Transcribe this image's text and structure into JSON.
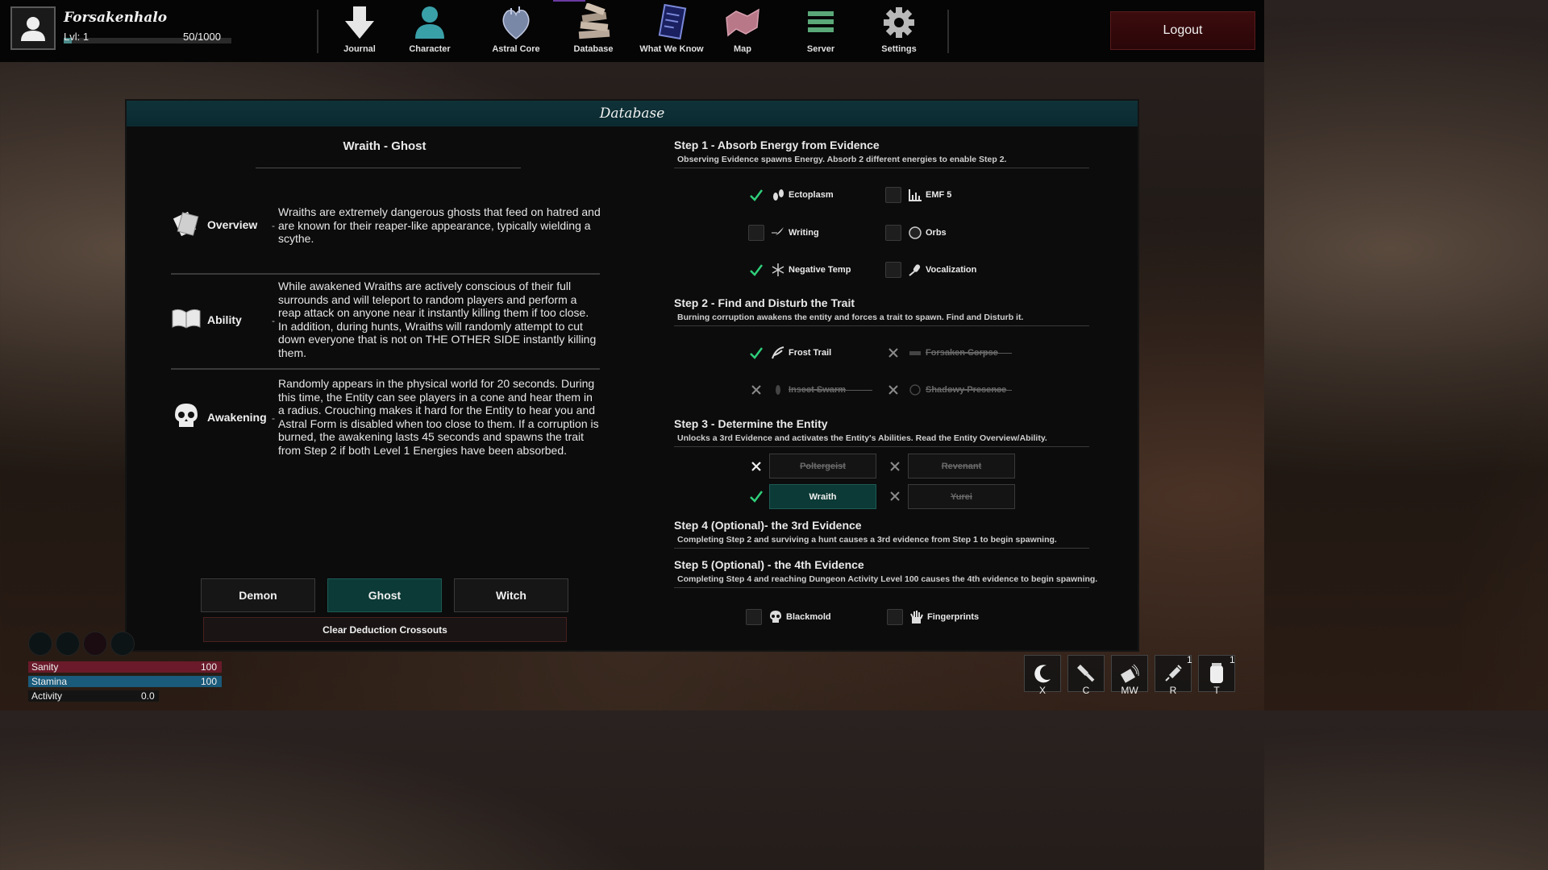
{
  "player": {
    "name": "Forsakenhalo",
    "level": "Lvl: 1",
    "xp": "50/1000",
    "xp_fraction": 0.05
  },
  "nav": [
    {
      "label": "Journal",
      "icon": "arrow-down-icon"
    },
    {
      "label": "Character",
      "icon": "person-icon"
    },
    {
      "label": "Astral Core",
      "icon": "heart-icon"
    },
    {
      "label": "Database",
      "icon": "books-icon"
    },
    {
      "label": "What We Know",
      "icon": "notebook-icon"
    },
    {
      "label": "Map",
      "icon": "map-icon"
    },
    {
      "label": "Server",
      "icon": "server-icon"
    },
    {
      "label": "Settings",
      "icon": "gear-icon"
    }
  ],
  "logout_label": "Logout",
  "panel": {
    "title": "Database",
    "entity_title": "Wraith - Ghost",
    "rows": [
      {
        "label": "Overview",
        "dash": "-",
        "text": "Wraiths are extremely dangerous ghosts that feed on hatred and are known for their reaper-like appearance, typically wielding a scythe."
      },
      {
        "label": "Ability",
        "dash": "-",
        "text": "While awakened Wraiths are actively conscious of their full surrounds and will teleport to random players and perform a reap attack on anyone near it instantly killing them if too close. In addition, during hunts, Wraiths will randomly attempt to cut down everyone that is not on THE OTHER SIDE instantly killing them."
      },
      {
        "label": "Awakening",
        "dash": "-",
        "text": "Randomly appears in the physical world for 20 seconds. During this time, the Entity can see players in a cone and hear them in a radius. Crouching makes it hard for the Entity to hear you and Astral Form is disabled when too close to them. If a corruption is burned, the awakening lasts 45 seconds and spawns the trait from Step 2 if both Level 1 Energies have been absorbed."
      }
    ],
    "class_buttons": [
      "Demon",
      "Ghost",
      "Witch"
    ],
    "active_class": "Ghost",
    "clear_label": "Clear Deduction Crossouts"
  },
  "steps": [
    {
      "title": "Step 1 - Absorb Energy from Evidence",
      "sub": "Observing Evidence spawns Energy. Absorb 2 different energies to enable Step 2."
    },
    {
      "title": "Step 2 - Find and Disturb the Trait",
      "sub": "Burning corruption awakens the entity and forces a trait to spawn. Find and Disturb it."
    },
    {
      "title": "Step 3 - Determine the Entity",
      "sub": "Unlocks a 3rd Evidence and activates the Entity's Abilities. Read the Entity Overview/Ability."
    },
    {
      "title": "Step 4 (Optional)- the 3rd Evidence",
      "sub": "Completing Step 2 and surviving a hunt causes a 3rd evidence from Step 1 to begin spawning."
    },
    {
      "title": "Step 5 (Optional) - the 4th Evidence",
      "sub": "Completing Step 4 and reaching Dungeon Activity Level 100 causes the 4th evidence to begin spawning."
    }
  ],
  "evidence_step1": [
    {
      "label": "Ectoplasm",
      "state": "checked",
      "icon": "footprint-icon"
    },
    {
      "label": "EMF 5",
      "state": "empty",
      "icon": "emf-icon"
    },
    {
      "label": "Writing",
      "state": "empty",
      "icon": "quill-icon"
    },
    {
      "label": "Orbs",
      "state": "empty",
      "icon": "orb-icon"
    },
    {
      "label": "Negative Temp",
      "state": "checked",
      "icon": "snowflake-icon"
    },
    {
      "label": "Vocalization",
      "state": "empty",
      "icon": "microphone-icon"
    }
  ],
  "traits_step2": [
    {
      "label": "Frost Trail",
      "state": "checked",
      "icon": "frost-icon"
    },
    {
      "label": "Forsaken Corpse",
      "state": "crossed",
      "icon": "corpse-icon"
    },
    {
      "label": "Insect Swarm",
      "state": "crossed",
      "icon": "insect-icon"
    },
    {
      "label": "Shadowy Presence",
      "state": "crossed",
      "icon": "shadow-icon"
    }
  ],
  "entities_step3": [
    {
      "label": "Poltergeist",
      "state": "crossed"
    },
    {
      "label": "Revenant",
      "state": "crossed"
    },
    {
      "label": "Wraith",
      "state": "checked"
    },
    {
      "label": "Yurei",
      "state": "crossed"
    }
  ],
  "evidence_step5": [
    {
      "label": "Blackmold",
      "state": "empty",
      "icon": "skull-icon"
    },
    {
      "label": "Fingerprints",
      "state": "empty",
      "icon": "hand-icon"
    }
  ],
  "hud": {
    "stats": [
      {
        "label": "Sanity",
        "value": "100",
        "fraction": 1.0,
        "color": "#6a1a2a"
      },
      {
        "label": "Stamina",
        "value": "100",
        "fraction": 1.0,
        "color": "#1a5a7a"
      },
      {
        "label": "Activity",
        "value": "0.0",
        "fraction": 0.0,
        "color": "#3a3a3a"
      }
    ],
    "slots": [
      {
        "key": "X",
        "icon": "moon-icon",
        "count": ""
      },
      {
        "key": "C",
        "icon": "flashlight-icon",
        "count": ""
      },
      {
        "key": "MW",
        "icon": "spirit-box-icon",
        "count": ""
      },
      {
        "key": "R",
        "icon": "syringe-icon",
        "count": "1"
      },
      {
        "key": "T",
        "icon": "jar-icon",
        "count": "1"
      }
    ]
  },
  "colors": {
    "accent_teal": "#0c3a36",
    "header_teal": "#0f3238",
    "logout_red": "#3c0c0e",
    "check_green": "#2fcf7a"
  }
}
